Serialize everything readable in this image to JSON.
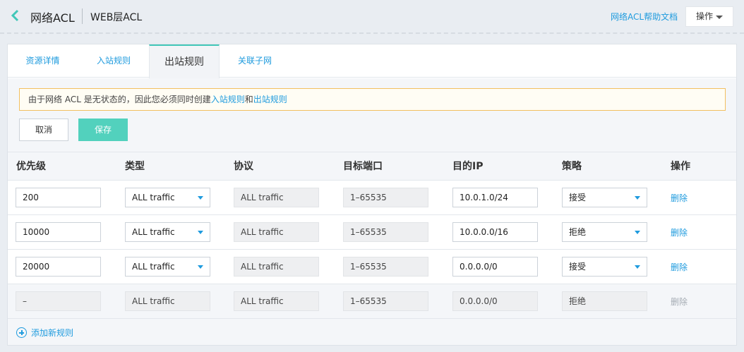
{
  "header": {
    "title": "网络ACL",
    "subtitle": "WEB层ACL",
    "help_link": "网络ACL帮助文档",
    "ops_button": "操作"
  },
  "tabs": [
    {
      "label": "资源详情"
    },
    {
      "label": "入站规则"
    },
    {
      "label": "出站规则"
    },
    {
      "label": "关联子网"
    }
  ],
  "notice": {
    "text": "由于网络 ACL 是无状态的，因此您必须同时创建",
    "link1": "入站规则",
    "and": "和",
    "link2": "出站规则"
  },
  "actions": {
    "cancel": "取消",
    "save": "保存"
  },
  "table": {
    "headers": [
      "优先级",
      "类型",
      "协议",
      "目标端口",
      "目的IP",
      "策略",
      "操作"
    ],
    "rows": [
      {
        "priority": "200",
        "type": "ALL traffic",
        "protocol": "ALL traffic",
        "port": "1–65535",
        "ip": "10.0.1.0/24",
        "policy": "接受",
        "action": "删除"
      },
      {
        "priority": "10000",
        "type": "ALL traffic",
        "protocol": "ALL traffic",
        "port": "1–65535",
        "ip": "10.0.0.0/16",
        "policy": "拒绝",
        "action": "删除"
      },
      {
        "priority": "20000",
        "type": "ALL traffic",
        "protocol": "ALL traffic",
        "port": "1–65535",
        "ip": "0.0.0.0/0",
        "policy": "接受",
        "action": "删除"
      },
      {
        "priority": "–",
        "type": "ALL traffic",
        "protocol": "ALL traffic",
        "port": "1–65535",
        "ip": "0.0.0.0/0",
        "policy": "拒绝",
        "action": "删除"
      }
    ]
  },
  "add_rule": "添加新规则",
  "colors": {
    "accent": "#52d1bd",
    "link": "#1f9bde",
    "notice_border": "#f2c061"
  }
}
